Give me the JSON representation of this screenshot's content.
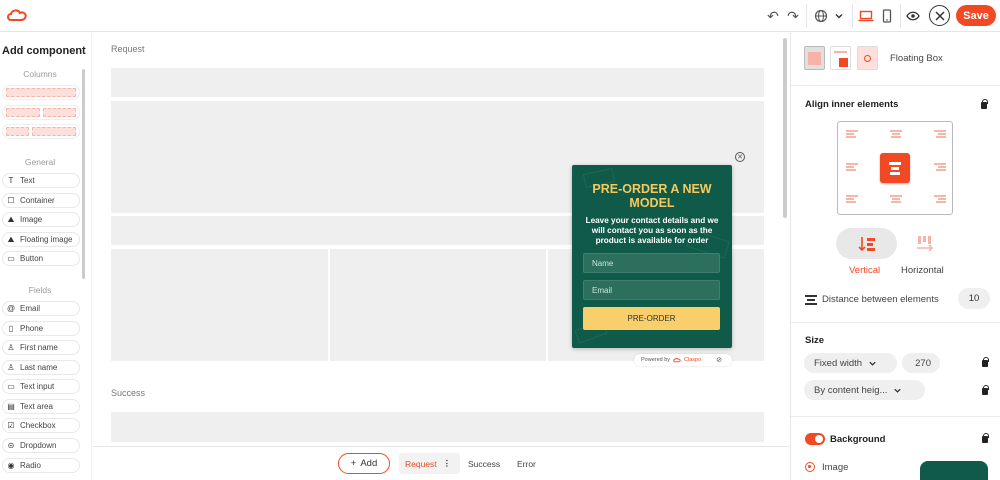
{
  "topbar": {
    "save_label": "Save"
  },
  "left_panel": {
    "title": "Add component",
    "sections": {
      "columns": "Columns",
      "general": "General",
      "fields": "Fields"
    },
    "general_items": [
      {
        "label": "Text",
        "icon": "text-icon"
      },
      {
        "label": "Container",
        "icon": "container-icon"
      },
      {
        "label": "Image",
        "icon": "image-icon"
      },
      {
        "label": "Floating image",
        "icon": "floating-image-icon"
      },
      {
        "label": "Button",
        "icon": "button-icon"
      }
    ],
    "field_items": [
      {
        "label": "Email",
        "icon": "at-icon"
      },
      {
        "label": "Phone",
        "icon": "phone-icon"
      },
      {
        "label": "First name",
        "icon": "person-icon"
      },
      {
        "label": "Last name",
        "icon": "person-icon"
      },
      {
        "label": "Text input",
        "icon": "input-icon"
      },
      {
        "label": "Text area",
        "icon": "textarea-icon"
      },
      {
        "label": "Checkbox",
        "icon": "checkbox-icon"
      },
      {
        "label": "Dropdown",
        "icon": "dropdown-icon"
      },
      {
        "label": "Radio",
        "icon": "radio-icon"
      }
    ]
  },
  "canvas": {
    "request_label": "Request",
    "success_label": "Success"
  },
  "popup": {
    "title": "PRE-ORDER A NEW MODEL",
    "text": "Leave your contact details and we will contact you as soon as the product is available for order",
    "name_placeholder": "Name",
    "email_placeholder": "Email",
    "button_label": "PRE-ORDER",
    "powered_by": "Powered by",
    "brand": "Claspo"
  },
  "bottombar": {
    "add_label": "Add",
    "tabs": [
      "Request",
      "Success",
      "Error"
    ]
  },
  "right_panel": {
    "floating_box_label": "Floating Box",
    "align_heading": "Align inner elements",
    "vertical_label": "Vertical",
    "horizontal_label": "Horizontal",
    "distance_label": "Distance between elements",
    "distance_value": "10",
    "size_heading": "Size",
    "width_mode": "Fixed width",
    "width_value": "270",
    "height_mode": "By content heig...",
    "background_heading": "Background",
    "image_label": "Image"
  },
  "colors": {
    "accent": "#f04923",
    "popup_bg": "#0f5a48",
    "popup_title": "#f7c95c",
    "popup_button": "#f8cf6b"
  }
}
